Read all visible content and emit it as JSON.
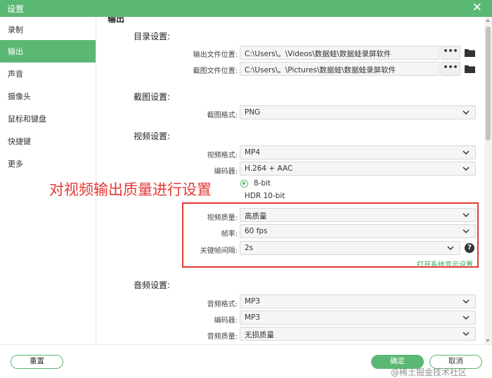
{
  "window": {
    "title": "设置",
    "close_glyph": "✕"
  },
  "sidebar": {
    "items": [
      {
        "label": "录制"
      },
      {
        "label": "输出",
        "active": true
      },
      {
        "label": "声音"
      },
      {
        "label": "摄像头"
      },
      {
        "label": "鼠标和键盘"
      },
      {
        "label": "快捷键"
      },
      {
        "label": "更多"
      }
    ]
  },
  "content": {
    "cut_title": "输出",
    "directory": {
      "title": "目录设置:",
      "output_label": "输出文件位置:",
      "output_path": "C:\\Users\\。\\Videos\\数据蛙\\数据蛙录屏软件",
      "screenshot_label": "截图文件位置:",
      "screenshot_path": "C:\\Users\\。\\Pictures\\数据蛙\\数据蛙录屏软件",
      "browse_label": "•••"
    },
    "screenshot": {
      "title": "截图设置:",
      "format_label": "截图格式:",
      "format_value": "PNG"
    },
    "video": {
      "title": "视频设置:",
      "format_label": "视频格式:",
      "format_value": "MP4",
      "encoder_label": "编码器:",
      "encoder_value": "H.264 + AAC",
      "bitdepth_option1": "8-bit",
      "bitdepth_option2": "HDR 10-bit",
      "quality_label": "视频质量:",
      "quality_value": "高质量",
      "framerate_label": "帧率:",
      "framerate_value": "60 fps",
      "keyframe_label": "关键帧间隔:",
      "keyframe_value": "2s",
      "help_glyph": "?",
      "display_link": "打开系统显示设置"
    },
    "audio": {
      "title": "音频设置:",
      "format_label": "音频格式:",
      "format_value": "MP3",
      "encoder_label": "编码器:",
      "encoder_value": "MP3",
      "quality_label": "音频质量:",
      "quality_value": "无损质量"
    },
    "annotation": "对视频输出质量进行设置"
  },
  "footer": {
    "reset_label": "重置",
    "ok_label": "确定",
    "cancel_label": "取消"
  },
  "watermark": "@稀土掘金技术社区",
  "colors": {
    "accent": "#5bb874",
    "annotation": "#e53935"
  }
}
